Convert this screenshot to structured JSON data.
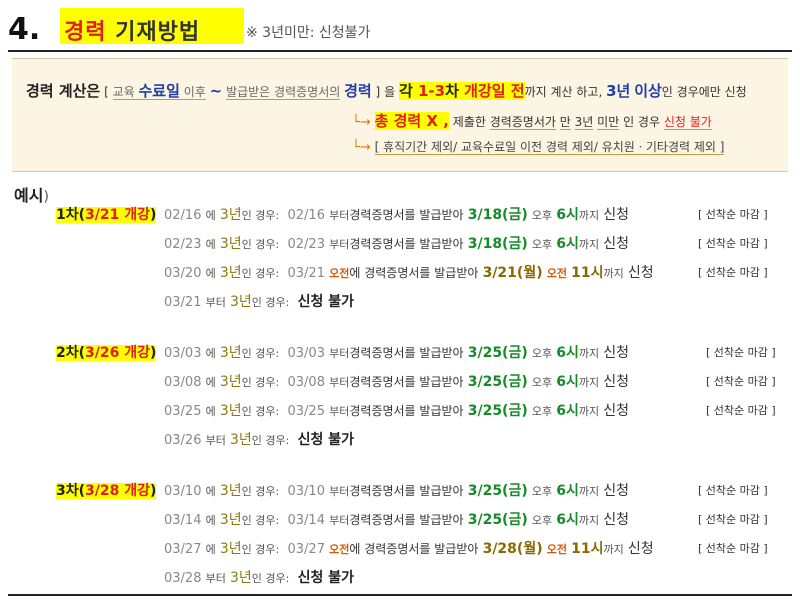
{
  "header": {
    "number": "4.",
    "title_a": "경력",
    "title_b": "기재방법",
    "note": "※ 3년미만: 신청불가"
  },
  "explain": {
    "lead": "경력 계산은",
    "br_open": "[",
    "edu": "교육",
    "completion": "수료일",
    "after": "이후",
    "tilde": "~",
    "issued": "발급받은 경력증명서의",
    "career": "경력",
    "br_close": "]",
    "eul": "을",
    "each": "각",
    "range": "1-3",
    "cha": "차",
    "open": "개강일",
    "before": "전",
    "tail1": "까지 계산 하고,",
    "three": "3년",
    "above": "이상",
    "tail2": "인 경우에만 신청",
    "arrow": "└→",
    "total_career": "총 경력 X ,",
    "sub1_a": "제출한",
    "sub1_b": "경력증명서가",
    "sub1_c": "만",
    "sub1_d": "3년",
    "sub1_e": "미만",
    "sub1_f": "인 경우",
    "sub1_g": "신청 불가",
    "sub2": "[ 휴직기간 제외/ 교육수료일 이전 경력 제외/ 유치원ㆍ기타경력 제외 ]"
  },
  "examples_title": "예시",
  "examples_paren": ")",
  "groups": [
    {
      "head_a": "1차(",
      "head_b": "3/21 개강",
      "head_c": ")",
      "rows": [
        {
          "d": "02/16",
          "ma": "에",
          "y": "3년",
          "mb": "인 경우:",
          "s": "02/16",
          "mc": "부터",
          "m": "경력증명서를 발급받아",
          "dl": "3/18(금)",
          "ap": "오후",
          "t": "6시",
          "kk": "까지",
          "ap2": "신청",
          "tag": "[ 선착순 마감 ]"
        },
        {
          "d": "02/23",
          "ma": "에",
          "y": "3년",
          "mb": "인 경우:",
          "s": "02/23",
          "mc": "부터",
          "m": "경력증명서를 발급받아",
          "dl": "3/18(금)",
          "ap": "오후",
          "t": "6시",
          "kk": "까지",
          "ap2": "신청",
          "tag": "[ 선착순 마감 ]"
        },
        {
          "d": "03/20",
          "ma": "에",
          "y": "3년",
          "mb": "인 경우:",
          "s": "03/21",
          "mc": "오전",
          "m": "에 경력증명서를 발급받아",
          "dl": "3/21(월)",
          "ap": "오전",
          "t": "11시",
          "kk": "까지",
          "ap2": "신청",
          "tag": "[ 선착순 마감 ]"
        }
      ],
      "last": {
        "d": "03/21",
        "a": "부터",
        "y": "3년",
        "b": "인 경우:",
        "c": "신청 불가"
      }
    },
    {
      "head_a": "2차(",
      "head_b": "3/26 개강",
      "head_c": ")",
      "rows": [
        {
          "d": "03/03",
          "ma": "에",
          "y": "3년",
          "mb": "인 경우:",
          "s": "03/03",
          "mc": "부터",
          "m": "경력증명서를 발급받아",
          "dl": "3/25(금)",
          "ap": "오후",
          "t": "6시",
          "kk": "까지",
          "ap2": "신청",
          "tag": "[ 선착순 마감 ]"
        },
        {
          "d": "03/08",
          "ma": "에",
          "y": "3년",
          "mb": "인 경우:",
          "s": "03/08",
          "mc": "부터",
          "m": "경력증명서를 발급받아",
          "dl": "3/25(금)",
          "ap": "오후",
          "t": "6시",
          "kk": "까지",
          "ap2": "신청",
          "tag": "[ 선착순 마감 ]"
        },
        {
          "d": "03/25",
          "ma": "에",
          "y": "3년",
          "mb": "인 경우:",
          "s": "03/25",
          "mc": "부터",
          "m": "경력증명서를 발급받아",
          "dl": "3/25(금)",
          "ap": "오후",
          "t": "6시",
          "kk": "까지",
          "ap2": "신청",
          "tag": "[ 선착순 마감 ]"
        }
      ],
      "last": {
        "d": "03/26",
        "a": "부터",
        "y": "3년",
        "b": "인 경우:",
        "c": "신청 불가"
      }
    },
    {
      "head_a": "3차(",
      "head_b": "3/28 개강",
      "head_c": ")",
      "rows": [
        {
          "d": "03/10",
          "ma": "에",
          "y": "3년",
          "mb": "인 경우:",
          "s": "03/10",
          "mc": "부터",
          "m": "경력증명서를 발급받아",
          "dl": "3/25(금)",
          "ap": "오후",
          "t": "6시",
          "kk": "까지",
          "ap2": "신청",
          "tag": "[ 선착순 마감 ]"
        },
        {
          "d": "03/14",
          "ma": "에",
          "y": "3년",
          "mb": "인 경우:",
          "s": "03/14",
          "mc": "부터",
          "m": "경력증명서를 발급받아",
          "dl": "3/25(금)",
          "ap": "오후",
          "t": "6시",
          "kk": "까지",
          "ap2": "신청",
          "tag": "[ 선착순 마감 ]"
        },
        {
          "d": "03/27",
          "ma": "에",
          "y": "3년",
          "mb": "인 경우:",
          "s": "03/27",
          "mc": "오전",
          "m": "에 경력증명서를 발급받아",
          "dl": "3/28(월)",
          "ap": "오전",
          "t": "11시",
          "kk": "까지",
          "ap2": "신청",
          "tag": "[ 선착순 마감 ]"
        }
      ],
      "last": {
        "d": "03/28",
        "a": "부터",
        "y": "3년",
        "b": "인 경우:",
        "c": "신청 불가"
      }
    }
  ]
}
